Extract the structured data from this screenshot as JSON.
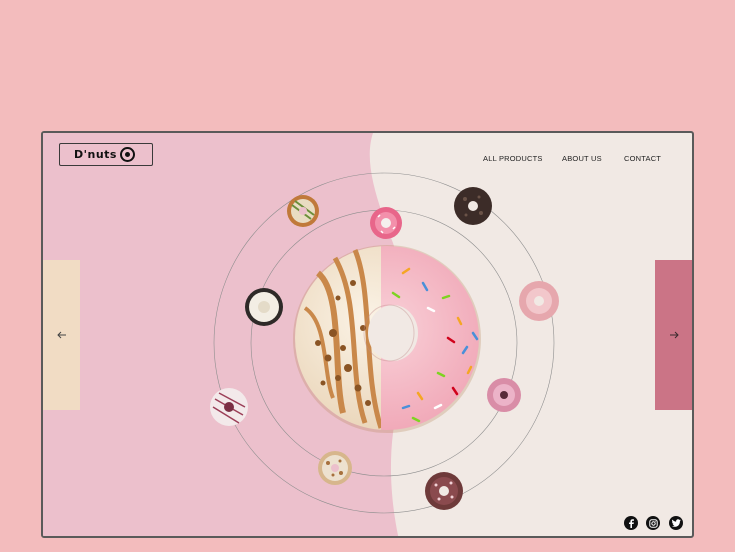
{
  "brand": {
    "name": "D'nuts",
    "logo_icon": "target-icon"
  },
  "nav": {
    "items": [
      "ALL PRODUCTS",
      "ABOUT US",
      "CONTACT"
    ]
  },
  "carousel": {
    "prev_icon": "arrow-left-icon",
    "next_icon": "arrow-right-icon"
  },
  "social": {
    "icons": [
      "facebook-icon",
      "instagram-icon",
      "twitter-icon"
    ]
  },
  "colors": {
    "page_bg": "#f3bcbd",
    "left_bg": "#ecc0cc",
    "right_bg": "#f1e9e4",
    "prev_panel": "#f1dcc4",
    "next_panel": "#cb7486"
  }
}
